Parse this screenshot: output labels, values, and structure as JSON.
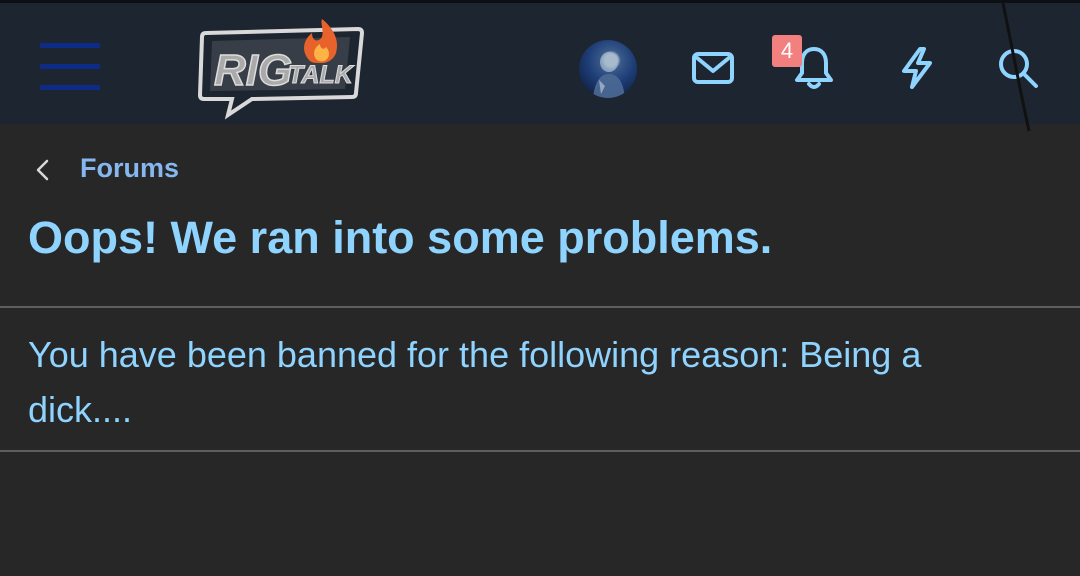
{
  "header": {
    "logo_text_primary": "RIG",
    "logo_text_secondary": "TALK",
    "alerts_badge_count": "4"
  },
  "breadcrumb": {
    "label": "Forums"
  },
  "page": {
    "title": "Oops! We ran into some problems.",
    "message": "You have been banned for the following reason: Being a dick...."
  },
  "icons": {
    "menu": "hamburger-menu-icon",
    "inbox": "envelope-icon",
    "alerts": "bell-icon",
    "whats_new": "lightning-bolt-icon",
    "search": "search-icon",
    "back": "chevron-left-icon"
  },
  "colors": {
    "header_bg": "#1d2530",
    "page_bg": "#272727",
    "accent_text": "#8fd3ff",
    "link_text": "#86b7ee",
    "icon_color": "#8fd3ff",
    "badge_bg": "#f2807f"
  }
}
